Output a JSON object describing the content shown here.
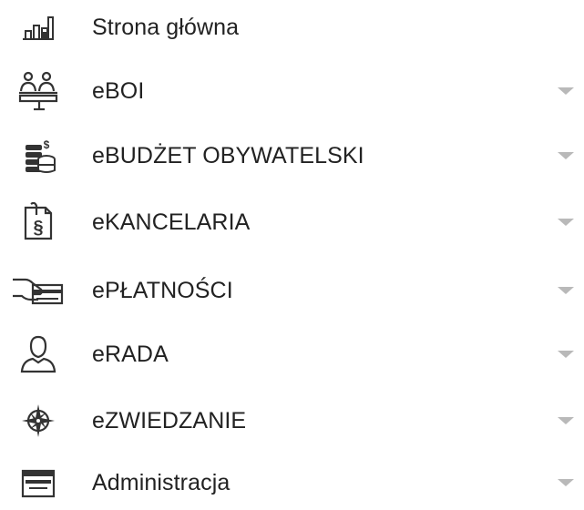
{
  "menu": {
    "items": [
      {
        "label": "Strona główna",
        "icon": "bar-chart-icon",
        "has_dropdown": false
      },
      {
        "label": "eBOI",
        "icon": "customer-service-icon",
        "has_dropdown": true
      },
      {
        "label": "eBUDŻET OBYWATELSKI",
        "icon": "coins-icon",
        "has_dropdown": true
      },
      {
        "label": "eKANCELARIA",
        "icon": "legal-document-icon",
        "has_dropdown": true
      },
      {
        "label": "ePŁATNOŚCI",
        "icon": "card-payment-icon",
        "has_dropdown": true
      },
      {
        "label": "eRADA",
        "icon": "user-icon",
        "has_dropdown": true
      },
      {
        "label": "eZWIEDZANIE",
        "icon": "compass-icon",
        "has_dropdown": true
      },
      {
        "label": "Administracja",
        "icon": "window-icon",
        "has_dropdown": true
      }
    ]
  },
  "colors": {
    "text": "#222222",
    "icon": "#333333",
    "caret": "#b9b9b9"
  }
}
